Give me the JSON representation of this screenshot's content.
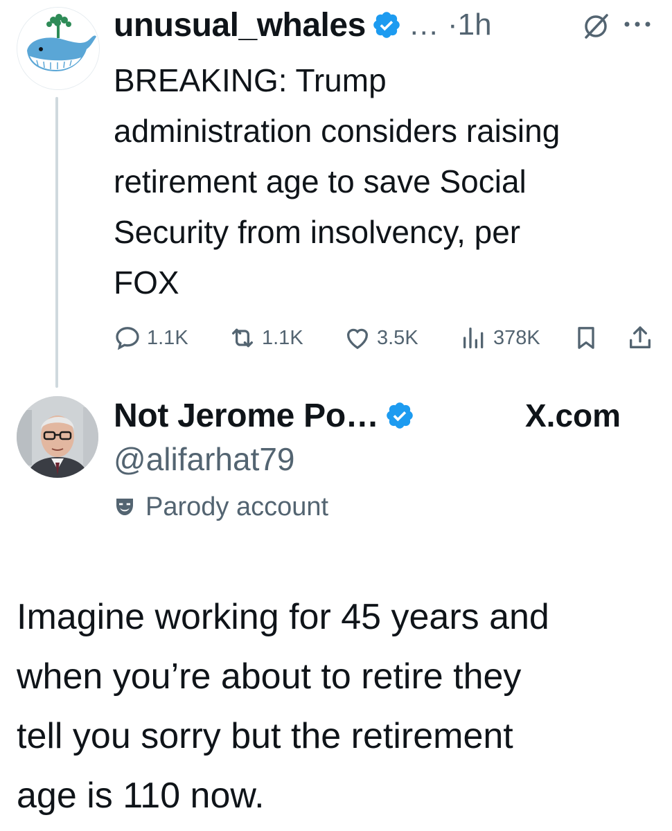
{
  "tweet1": {
    "display_name": "unusual_whales",
    "meta": "… ·1h",
    "text": "BREAKING: Trump\nadministration considers raising\nretirement age to save Social\nSecurity from insolvency, per\nFOX",
    "actions": {
      "replies": "1.1K",
      "reposts": "1.1K",
      "likes": "3.5K",
      "views": "378K"
    },
    "icons": [
      "verified-badge-icon",
      "grok-icon",
      "more-icon",
      "reply-icon",
      "repost-icon",
      "like-icon",
      "views-icon",
      "bookmark-icon",
      "share-icon"
    ]
  },
  "tweet2": {
    "display_name": "Not Jerome Po…",
    "source": "X.com",
    "handle": "@alifarhat79",
    "label": "Parody account",
    "text": "Imagine working for 45 years and\nwhen you’re about to retire they\ntell you sorry but the retirement\nage is 110 now.",
    "icons": [
      "verified-badge-icon",
      "parody-mask-icon"
    ]
  },
  "colors": {
    "text": "#0f1419",
    "secondary": "#536471",
    "verified_blue": "#1d9bf0",
    "thread_line": "#cfd9de"
  }
}
